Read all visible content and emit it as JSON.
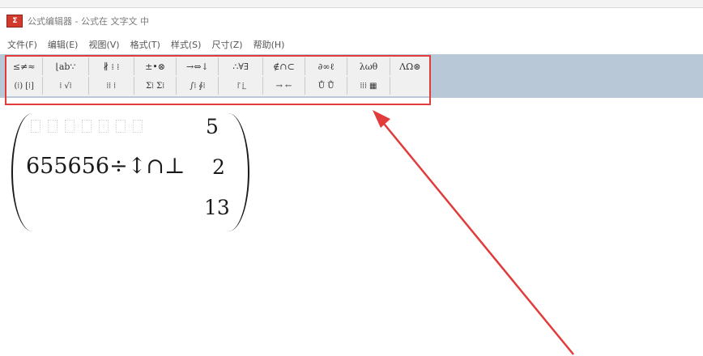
{
  "window": {
    "title": "公式编辑器 - 公式在 文字文 中",
    "icon": "formula-editor-icon"
  },
  "menu": [
    "文件(F)",
    "编辑(E)",
    "视图(V)",
    "格式(T)",
    "样式(S)",
    "尺寸(Z)",
    "帮助(H)"
  ],
  "toolbar": {
    "row1": [
      "≤≠≈",
      "⌊ab∵",
      "∦ ⁞ ⁞",
      "±•⊗",
      "→⇔↓",
      "∴∀∃",
      "∉∩⊂",
      "∂∞ℓ",
      "λωθ",
      "ΛΩ⊛"
    ],
    "row2": [
      "(⁞) [⁞]",
      "⁞ √⁞",
      "⁞⁞ ⁞",
      "Σ⁞ Σ⁞",
      "∫⁞ ∮⁞",
      "⁞̄ ⁞̲",
      "→ ←",
      "Ů Ů̇",
      "⁞⁞⁞ ▦",
      ""
    ]
  },
  "equation": {
    "top_right": "5",
    "middle": "655656÷↕∩⊥",
    "middle_right": "2",
    "bottom_right": "13"
  },
  "colors": {
    "highlight": "#e23b3b",
    "toolbar_band": "#b9c8d6",
    "toolbar_bg": "#f0f0f0"
  }
}
